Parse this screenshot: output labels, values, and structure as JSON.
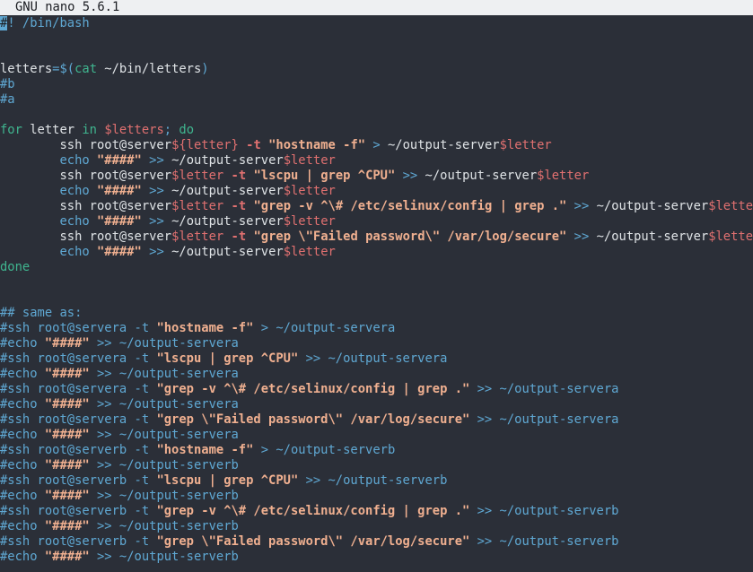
{
  "window": {
    "title": "GNU nano 5.6.1"
  },
  "colors": {
    "background": "#2b2f38",
    "titlebar_bg": "#eef0f2",
    "comment": "#5fa8d3",
    "keyword": "#3fb58f",
    "variable": "#e07070",
    "string": "#f0b090",
    "text": "#dfe3e6"
  },
  "editor": {
    "cursor_char": "#",
    "lines": [
      [
        [
          "cmt",
          "! /bin/bash"
        ]
      ],
      [],
      [],
      [
        [
          "plain",
          "letters"
        ],
        [
          "op",
          "=$("
        ],
        [
          "kw",
          "cat"
        ],
        [
          "plain",
          " ~/bin/letters"
        ],
        [
          "op",
          ")"
        ]
      ],
      [
        [
          "cmt",
          "#b"
        ]
      ],
      [
        [
          "cmt",
          "#a"
        ]
      ],
      [],
      [
        [
          "kw",
          "for"
        ],
        [
          "plain",
          " letter "
        ],
        [
          "kw",
          "in"
        ],
        [
          "plain",
          " "
        ],
        [
          "var",
          "$letters"
        ],
        [
          "op",
          "; "
        ],
        [
          "kw",
          "do"
        ]
      ],
      [
        [
          "plain",
          "        ssh root@server"
        ],
        [
          "var",
          "${letter}"
        ],
        [
          "plain",
          " "
        ],
        [
          "flag",
          "-t"
        ],
        [
          "plain",
          " "
        ],
        [
          "str",
          "\"hostname -f\""
        ],
        [
          "plain",
          " "
        ],
        [
          "op",
          ">"
        ],
        [
          "plain",
          " ~/output-server"
        ],
        [
          "var",
          "$letter"
        ]
      ],
      [
        [
          "plain",
          "        "
        ],
        [
          "op",
          "echo"
        ],
        [
          "plain",
          " "
        ],
        [
          "str",
          "\"####\""
        ],
        [
          "plain",
          " "
        ],
        [
          "op",
          ">>"
        ],
        [
          "plain",
          " ~/output-server"
        ],
        [
          "var",
          "$letter"
        ]
      ],
      [
        [
          "plain",
          "        ssh root@server"
        ],
        [
          "var",
          "$letter"
        ],
        [
          "plain",
          " "
        ],
        [
          "flag",
          "-t"
        ],
        [
          "plain",
          " "
        ],
        [
          "str",
          "\"lscpu | grep ^CPU\""
        ],
        [
          "plain",
          " "
        ],
        [
          "op",
          ">>"
        ],
        [
          "plain",
          " ~/output-server"
        ],
        [
          "var",
          "$letter"
        ]
      ],
      [
        [
          "plain",
          "        "
        ],
        [
          "op",
          "echo"
        ],
        [
          "plain",
          " "
        ],
        [
          "str",
          "\"####\""
        ],
        [
          "plain",
          " "
        ],
        [
          "op",
          ">>"
        ],
        [
          "plain",
          " ~/output-server"
        ],
        [
          "var",
          "$letter"
        ]
      ],
      [
        [
          "plain",
          "        ssh root@server"
        ],
        [
          "var",
          "$letter"
        ],
        [
          "plain",
          " "
        ],
        [
          "flag",
          "-t"
        ],
        [
          "plain",
          " "
        ],
        [
          "str",
          "\"grep -v ^\\# /etc/selinux/config | grep .\""
        ],
        [
          "plain",
          " "
        ],
        [
          "op",
          ">>"
        ],
        [
          "plain",
          " ~/output-server"
        ],
        [
          "var",
          "$letter"
        ]
      ],
      [
        [
          "plain",
          "        "
        ],
        [
          "op",
          "echo"
        ],
        [
          "plain",
          " "
        ],
        [
          "str",
          "\"####\""
        ],
        [
          "plain",
          " "
        ],
        [
          "op",
          ">>"
        ],
        [
          "plain",
          " ~/output-server"
        ],
        [
          "var",
          "$letter"
        ]
      ],
      [
        [
          "plain",
          "        ssh root@server"
        ],
        [
          "var",
          "$letter"
        ],
        [
          "plain",
          " "
        ],
        [
          "flag",
          "-t"
        ],
        [
          "plain",
          " "
        ],
        [
          "str",
          "\"grep \\\"Failed password\\\" /var/log/secure\""
        ],
        [
          "plain",
          " "
        ],
        [
          "op",
          ">>"
        ],
        [
          "plain",
          " ~/output-server"
        ],
        [
          "var",
          "$letter"
        ]
      ],
      [
        [
          "plain",
          "        "
        ],
        [
          "op",
          "echo"
        ],
        [
          "plain",
          " "
        ],
        [
          "str",
          "\"####\""
        ],
        [
          "plain",
          " "
        ],
        [
          "op",
          ">>"
        ],
        [
          "plain",
          " ~/output-server"
        ],
        [
          "var",
          "$letter"
        ]
      ],
      [
        [
          "kw",
          "done"
        ]
      ],
      [],
      [],
      [
        [
          "cmt",
          "## same as:"
        ]
      ],
      [
        [
          "cmt",
          "#ssh root@servera -t "
        ],
        [
          "str",
          "\"hostname -f\""
        ],
        [
          "cmt",
          " > ~/output-servera"
        ]
      ],
      [
        [
          "cmt",
          "#echo "
        ],
        [
          "str",
          "\"####\""
        ],
        [
          "cmt",
          " >> ~/output-servera"
        ]
      ],
      [
        [
          "cmt",
          "#ssh root@servera -t "
        ],
        [
          "str",
          "\"lscpu | grep ^CPU\""
        ],
        [
          "cmt",
          " >> ~/output-servera"
        ]
      ],
      [
        [
          "cmt",
          "#echo "
        ],
        [
          "str",
          "\"####\""
        ],
        [
          "cmt",
          " >> ~/output-servera"
        ]
      ],
      [
        [
          "cmt",
          "#ssh root@servera -t "
        ],
        [
          "str",
          "\"grep -v ^\\# /etc/selinux/config | grep .\""
        ],
        [
          "cmt",
          " >> ~/output-servera"
        ]
      ],
      [
        [
          "cmt",
          "#echo "
        ],
        [
          "str",
          "\"####\""
        ],
        [
          "cmt",
          " >> ~/output-servera"
        ]
      ],
      [
        [
          "cmt",
          "#ssh root@servera -t "
        ],
        [
          "str",
          "\"grep \\\"Failed password\\\" /var/log/secure\""
        ],
        [
          "cmt",
          " >> ~/output-servera"
        ]
      ],
      [
        [
          "cmt",
          "#echo "
        ],
        [
          "str",
          "\"####\""
        ],
        [
          "cmt",
          " >> ~/output-servera"
        ]
      ],
      [
        [
          "cmt",
          "#ssh root@serverb -t "
        ],
        [
          "str",
          "\"hostname -f\""
        ],
        [
          "cmt",
          " > ~/output-serverb"
        ]
      ],
      [
        [
          "cmt",
          "#echo "
        ],
        [
          "str",
          "\"####\""
        ],
        [
          "cmt",
          " >> ~/output-serverb"
        ]
      ],
      [
        [
          "cmt",
          "#ssh root@serverb -t "
        ],
        [
          "str",
          "\"lscpu | grep ^CPU\""
        ],
        [
          "cmt",
          " >> ~/output-serverb"
        ]
      ],
      [
        [
          "cmt",
          "#echo "
        ],
        [
          "str",
          "\"####\""
        ],
        [
          "cmt",
          " >> ~/output-serverb"
        ]
      ],
      [
        [
          "cmt",
          "#ssh root@serverb -t "
        ],
        [
          "str",
          "\"grep -v ^\\# /etc/selinux/config | grep .\""
        ],
        [
          "cmt",
          " >> ~/output-serverb"
        ]
      ],
      [
        [
          "cmt",
          "#echo "
        ],
        [
          "str",
          "\"####\""
        ],
        [
          "cmt",
          " >> ~/output-serverb"
        ]
      ],
      [
        [
          "cmt",
          "#ssh root@serverb -t "
        ],
        [
          "str",
          "\"grep \\\"Failed password\\\" /var/log/secure\""
        ],
        [
          "cmt",
          " >> ~/output-serverb"
        ]
      ],
      [
        [
          "cmt",
          "#echo "
        ],
        [
          "str",
          "\"####\""
        ],
        [
          "cmt",
          " >> ~/output-serverb"
        ]
      ]
    ]
  }
}
